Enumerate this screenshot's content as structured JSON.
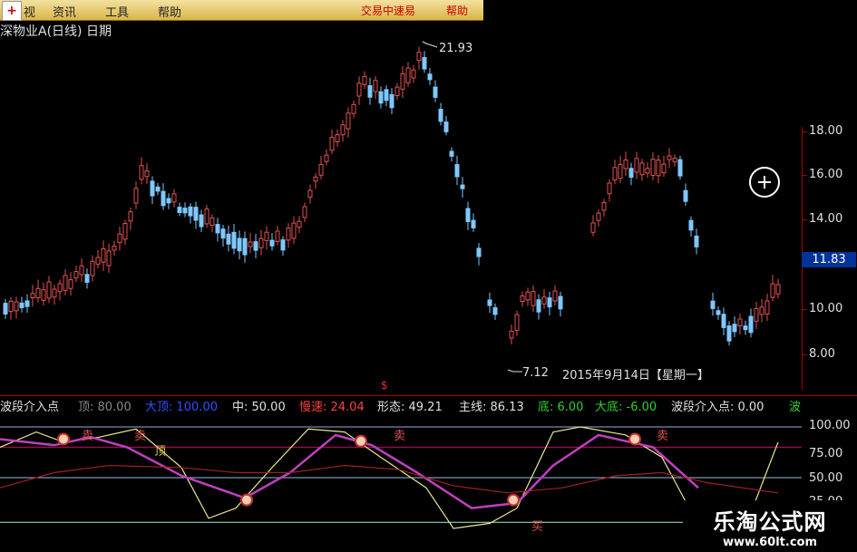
{
  "menubar": {
    "items": [
      "资讯",
      "工具",
      "帮助"
    ],
    "truncated_left": "视",
    "right_items": [
      "交易中速易",
      "帮助"
    ]
  },
  "stock": {
    "title": "深物业A(日线) 日期"
  },
  "price_axis": {
    "ticks": [
      "18.00",
      "16.00",
      "14.00",
      "10.00",
      "8.00"
    ],
    "current_price": "11.83"
  },
  "annotations": {
    "high_label": "21.93",
    "low_label": "7.12",
    "date_label": "2015年9月14日【星期一】",
    "mid_marker": "$"
  },
  "indicator": {
    "name": "波段介入点",
    "top_label": "顶: 80.00",
    "big_top_label": "大顶: 100.00",
    "mid_label": "中: 50.00",
    "speed_label": "慢速: 24.04",
    "form_label": "形态: 49.21",
    "main_label": "主线: 86.13",
    "bottom_label": "底: 6.00",
    "big_bottom_label": "大底: -6.00",
    "entry_label": "波段介入点: 0.00",
    "trailing": "波",
    "ticks": [
      "100.00",
      "75.00",
      "50.00",
      "25.00"
    ],
    "signal_sell": "卖",
    "signal_buy": "买",
    "signal_top": "顶"
  },
  "watermark": {
    "title": "乐淘公式网",
    "url": "www.60lt.com"
  },
  "colors": {
    "up": "#e05050",
    "down": "#7ec8ff",
    "main_line": "#e8e890",
    "form_line": "#c040c0",
    "speed_line": "#a02020"
  }
}
